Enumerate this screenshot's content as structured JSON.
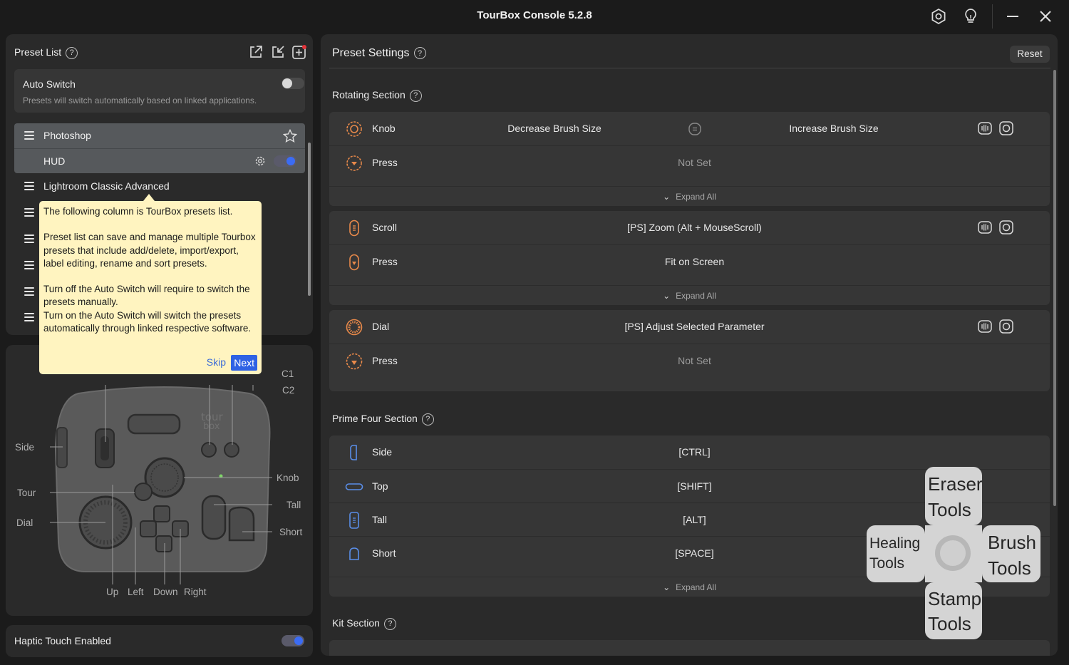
{
  "window": {
    "title": "TourBox Console 5.2.8"
  },
  "preset_list": {
    "title": "Preset List",
    "auto_switch": {
      "label": "Auto Switch",
      "description": "Presets will switch automatically based on linked applications.",
      "enabled": false
    },
    "presets": [
      {
        "name": "Photoshop",
        "selected": true
      },
      {
        "name": "HUD",
        "selected": true,
        "hud_enabled": true
      },
      {
        "name": "Lightroom Classic Advanced",
        "selected": false
      }
    ]
  },
  "tooltip": {
    "line1": "The following column is TourBox presets list.",
    "para2": "Preset list can save and manage multiple Tourbox presets that include add/delete, import/export, label editing, rename and sort presets.",
    "para3a": "Turn off the Auto Switch will require to switch the presets manually.",
    "para3b": "Turn on the Auto Switch will switch the presets automatically through linked respective software.",
    "skip": "Skip",
    "next": "Next"
  },
  "device_labels": {
    "c1": "C1",
    "c2": "C2",
    "side": "Side",
    "tour": "Tour",
    "dial": "Dial",
    "knob": "Knob",
    "tall": "Tall",
    "short": "Short",
    "up": "Up",
    "left": "Left",
    "down": "Down",
    "right": "Right",
    "brand": "tour box"
  },
  "haptic": {
    "label": "Haptic Touch Enabled",
    "enabled": true
  },
  "preset_settings": {
    "title": "Preset Settings",
    "reset": "Reset",
    "rotating": {
      "title": "Rotating Section",
      "knob": {
        "name": "Knob",
        "left": "Decrease Brush Size",
        "right": "Increase Brush Size"
      },
      "knob_press": {
        "name": "Press",
        "value": "Not Set"
      },
      "expand1": "Expand All",
      "scroll": {
        "name": "Scroll",
        "value": "[PS] Zoom (Alt + MouseScroll)"
      },
      "scroll_press": {
        "name": "Press",
        "value": "Fit on Screen"
      },
      "expand2": "Expand All",
      "dial": {
        "name": "Dial",
        "value": "[PS] Adjust Selected Parameter"
      },
      "dial_press": {
        "name": "Press",
        "value": "Not Set"
      }
    },
    "prime_four": {
      "title": "Prime Four Section",
      "side": {
        "name": "Side",
        "value": "[CTRL]"
      },
      "top": {
        "name": "Top",
        "value": "[SHIFT]"
      },
      "tall": {
        "name": "Tall",
        "value": "[ALT]"
      },
      "short": {
        "name": "Short",
        "value": "[SPACE]"
      },
      "expand": "Expand All"
    },
    "kit": {
      "title": "Kit Section"
    }
  },
  "radial_menu": {
    "top": [
      "Eraser",
      "Tools"
    ],
    "left": [
      "Healing",
      "Tools"
    ],
    "right": [
      "Brush",
      "Tools"
    ],
    "bottom": [
      "Stamp",
      "Tools"
    ]
  },
  "colors": {
    "accent": "#3b6cf4",
    "tooltip_bg": "#fff4c0",
    "panel": "#2a2a2a"
  }
}
